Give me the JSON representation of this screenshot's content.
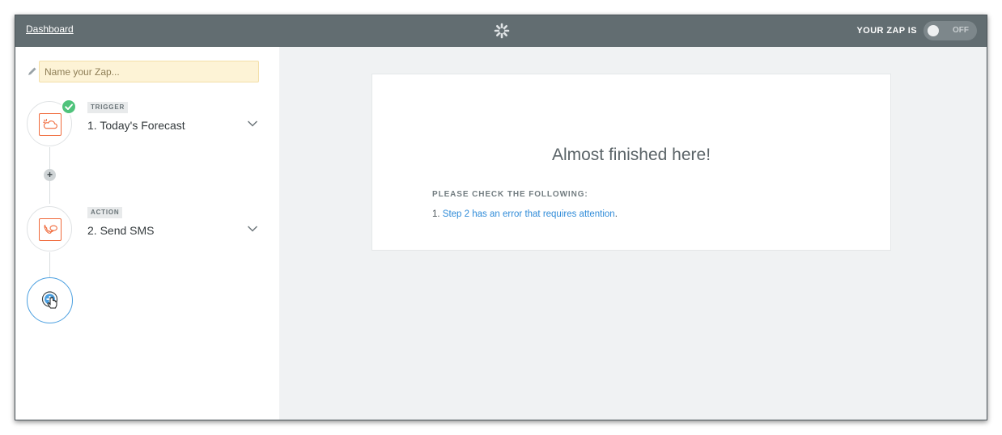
{
  "topbar": {
    "dashboard_label": "Dashboard",
    "status_label": "YOUR ZAP IS",
    "toggle_label": "OFF",
    "background_color": "#626d71"
  },
  "sidebar": {
    "name_placeholder": "Name your Zap...",
    "steps": [
      {
        "tag": "TRIGGER",
        "title": "1. Today's Forecast",
        "icon": "weather-cloud-sun-icon",
        "completed": true
      },
      {
        "tag": "ACTION",
        "title": "2. Send SMS",
        "icon": "sms-phone-icon",
        "completed": false
      }
    ],
    "add_step_icon": "plus-icon"
  },
  "card": {
    "title": "Almost finished here!",
    "subheading": "PLEASE CHECK THE FOLLOWING:",
    "items": [
      {
        "number": "1.",
        "link_text": "Step 2 has an error that requires attention",
        "suffix": "."
      }
    ]
  },
  "colors": {
    "accent_orange": "#f06a3b",
    "success_green": "#4fc37b",
    "link_blue": "#2f8bd8",
    "name_field_bg": "#fdf3d6"
  }
}
